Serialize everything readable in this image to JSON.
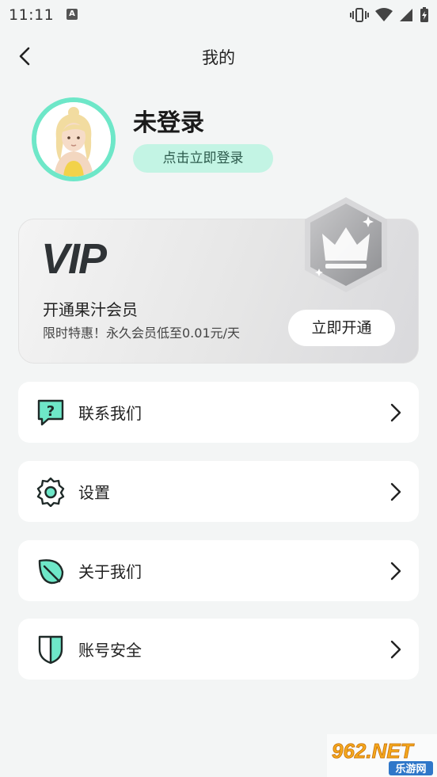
{
  "status_bar": {
    "time": "11:11",
    "notification_letter": "A"
  },
  "header": {
    "title": "我的",
    "back_icon": "chevron-left-icon"
  },
  "profile": {
    "name": "未登录",
    "login_button": "点击立即登录",
    "ring_color": "#6ee7c8"
  },
  "vip": {
    "logo_text": "VIP",
    "title": "开通果汁会员",
    "subtitle": "限时特惠！永久会员低至0.01元/天",
    "button": "立即开通"
  },
  "menu": [
    {
      "label": "联系我们",
      "icon": "question-chat-icon"
    },
    {
      "label": "设置",
      "icon": "gear-icon"
    },
    {
      "label": "关于我们",
      "icon": "leaf-icon"
    },
    {
      "label": "账号安全",
      "icon": "shield-icon"
    }
  ],
  "watermark": {
    "top": "962.NET",
    "bottom": "乐游网"
  },
  "colors": {
    "accent": "#6ee7c8",
    "accent_light": "#c3f4e4"
  }
}
